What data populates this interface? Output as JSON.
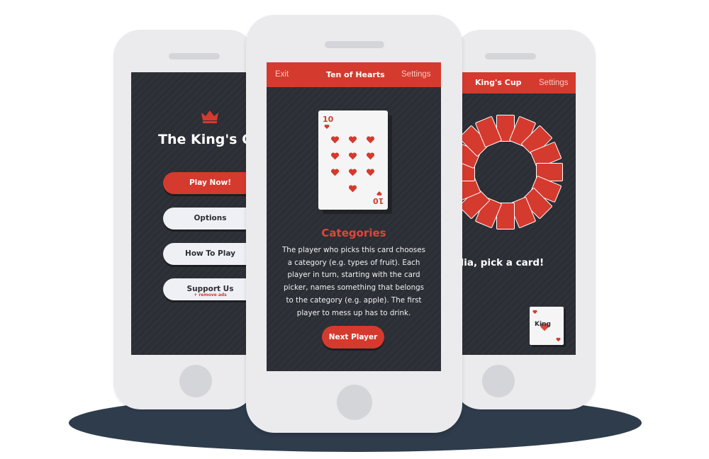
{
  "colors": {
    "accent": "#d53a2e",
    "screen_bg": "#2b2e34",
    "phone_frame": "#ebebee",
    "shadow": "#2f3c4c"
  },
  "left_phone": {
    "crown_icon": "crown-icon",
    "title": "The King's Cu",
    "buttons": {
      "play": "Play Now!",
      "options": "Options",
      "how_to": "How To Play",
      "support": "Support Us",
      "support_sub": "+ remove ads"
    }
  },
  "center_phone": {
    "topbar": {
      "exit": "Exit",
      "title": "Ten of Hearts",
      "settings": "Settings"
    },
    "card": {
      "rank": "10",
      "suit_icon": "heart-icon"
    },
    "heading": "Categories",
    "description": "The player who picks this card chooses a category (e.g. types of fruit). Each player in turn, starting with the card picker, names something that belongs to the category (e.g. apple). The first player to mess up has to drink.",
    "next_button": "Next Player"
  },
  "right_phone": {
    "topbar": {
      "title": "King's Cup",
      "settings": "Settings"
    },
    "prompt": "ulia, pick a card!",
    "mini_card_label": "King"
  }
}
